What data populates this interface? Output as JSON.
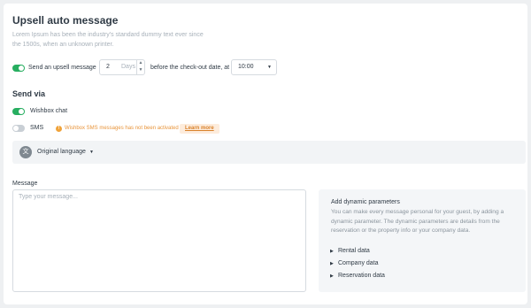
{
  "section_title": "Upsell auto message",
  "description": "Lorem Ipsum has been the industry's standard dummy text ever since the 1500s, when an unknown printer.",
  "upsell": {
    "enabled": true,
    "label": "Send an upsell message",
    "days_value": "2",
    "days_unit": "Days",
    "before_text": "before the check-out date, at",
    "time_value": "10:00"
  },
  "send_via": {
    "title": "Send via",
    "wishbox_chat": {
      "label": "Wishbox chat",
      "enabled": true
    },
    "sms": {
      "label": "SMS",
      "enabled": false,
      "warning": "Wishbox SMS messages has not been activated",
      "learn_more": "Learn more"
    }
  },
  "language": {
    "label": "Original language"
  },
  "message": {
    "label": "Message",
    "placeholder": "Type your message..."
  },
  "dynamic": {
    "title": "Add dynamic parameters",
    "text": "You can make every message personal for your guest, by adding a dynamic parameter. The dynamic parameters are details from the reservation or the property info or your company data.",
    "items": [
      "Rental data",
      "Company data",
      "Reservation data"
    ]
  },
  "colors": {
    "toggle_on": "#27ae60",
    "warning": "#f0a33a"
  },
  "icons": [
    "toggle-switch",
    "stepper-arrows",
    "chevron-down-icon",
    "warning-icon",
    "translate-icon",
    "caret-right-icon"
  ]
}
